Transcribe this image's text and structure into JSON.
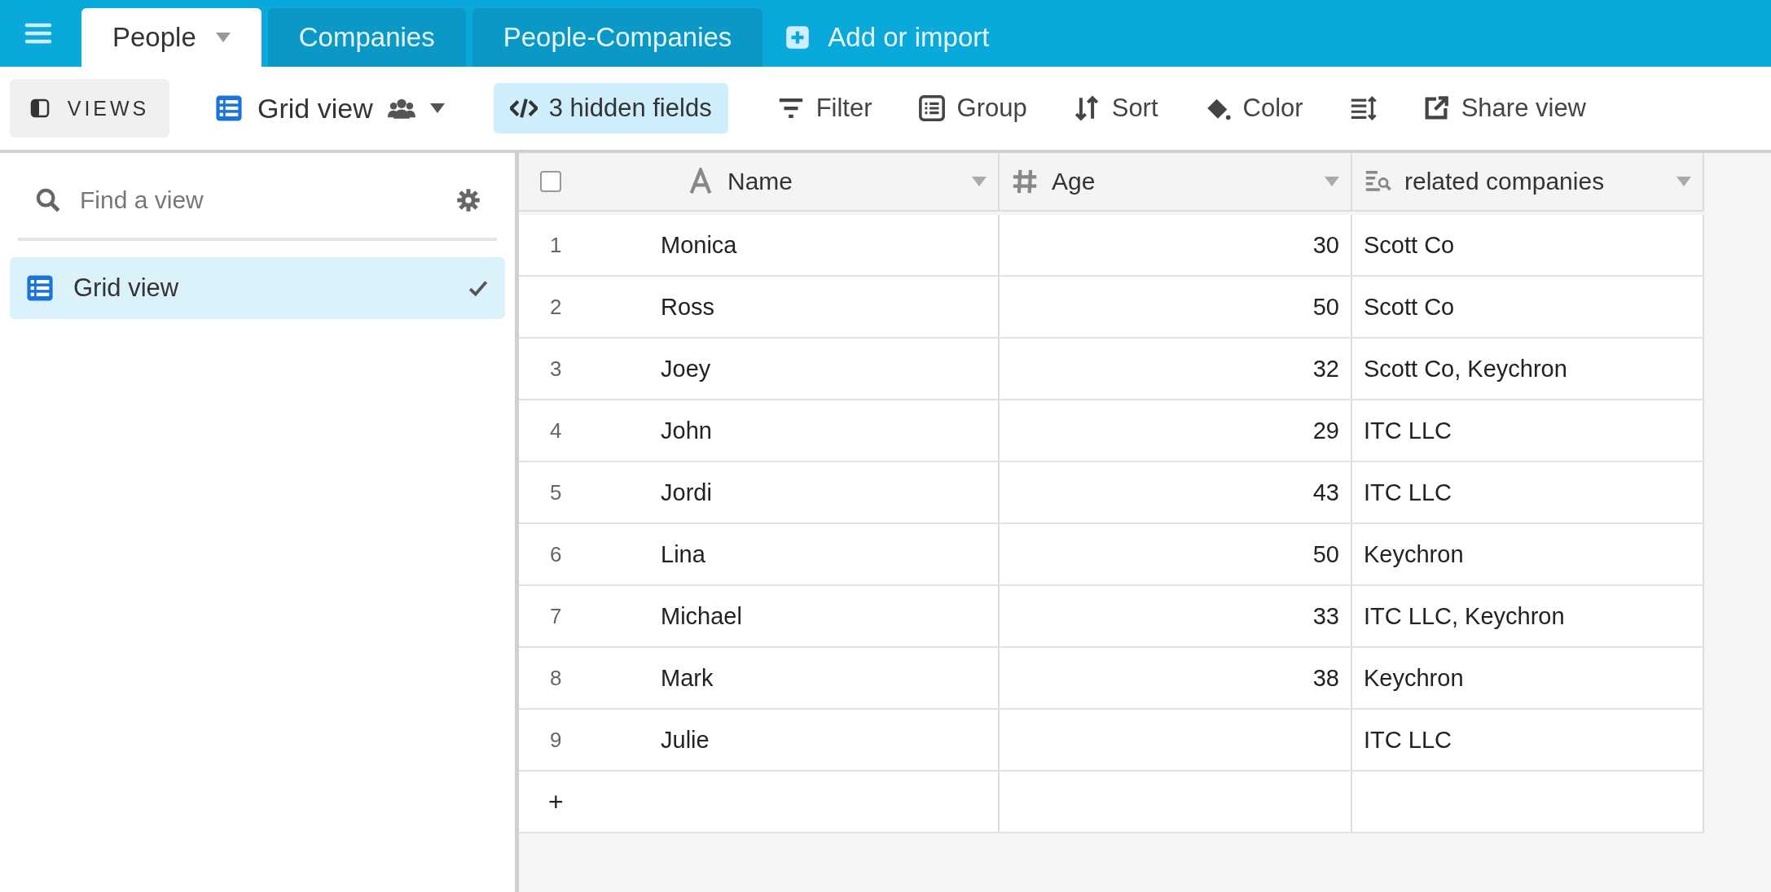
{
  "tabs": [
    {
      "label": "People",
      "selected": true
    },
    {
      "label": "Companies",
      "selected": false
    },
    {
      "label": "People-Companies",
      "selected": false
    }
  ],
  "add_table": {
    "label": "Add or import"
  },
  "toolbar": {
    "views_button": "VIEWS",
    "view_name": "Grid view",
    "hidden_fields": "3 hidden fields",
    "filter": "Filter",
    "group": "Group",
    "sort": "Sort",
    "color_button": "Color",
    "share": "Share view"
  },
  "sidebar": {
    "search": {
      "placeholder": "Find a view"
    },
    "items": [
      {
        "label": "Grid view",
        "selected": true
      }
    ]
  },
  "table": {
    "select_all": {
      "checked": false
    },
    "columns": [
      {
        "label": "Name",
        "kind": "text"
      },
      {
        "label": "Age",
        "kind": "number"
      },
      {
        "label": "related companies",
        "kind": "lookup"
      }
    ],
    "rows": [
      {
        "number": "1",
        "name": "Monica",
        "age": "30",
        "companies": "Scott Co"
      },
      {
        "number": "2",
        "name": "Ross",
        "age": "50",
        "companies": "Scott Co"
      },
      {
        "number": "3",
        "name": "Joey",
        "age": "32",
        "companies": "Scott Co, Keychron"
      },
      {
        "number": "4",
        "name": "John",
        "age": "29",
        "companies": "ITC LLC"
      },
      {
        "number": "5",
        "name": "Jordi",
        "age": "43",
        "companies": "ITC LLC"
      },
      {
        "number": "6",
        "name": "Lina",
        "age": "50",
        "companies": "Keychron"
      },
      {
        "number": "7",
        "name": "Michael",
        "age": "33",
        "companies": "ITC LLC, Keychron"
      },
      {
        "number": "8",
        "name": "Mark",
        "age": "38",
        "companies": "Keychron"
      },
      {
        "number": "9",
        "name": "Julie",
        "companies": "ITC LLC"
      }
    ],
    "add_row": "+"
  }
}
